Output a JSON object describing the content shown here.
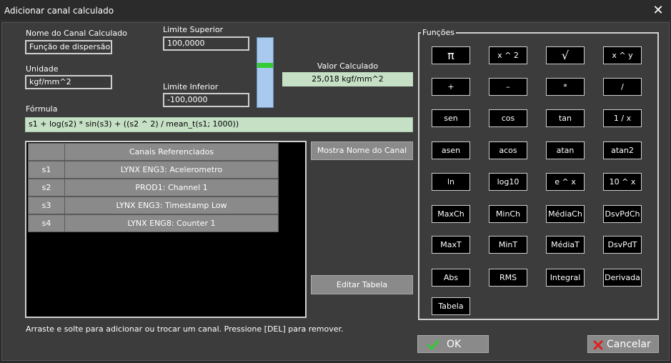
{
  "window": {
    "title": "Adicionar canal calculado",
    "close_glyph": "✕"
  },
  "form": {
    "channel_name_label": "Nome do Canal Calculado",
    "channel_name_value": "Função de dispersão",
    "unit_label": "Unidade",
    "unit_value": "kgf/mm^2",
    "upper_limit_label": "Limite Superior",
    "upper_limit_value": "100,0000",
    "lower_limit_label": "Limite Inferior",
    "lower_limit_value": "-100,0000",
    "calc_value_label": "Valor Calculado",
    "calc_value": "25,018 kgf/mm^2",
    "formula_label": "Fórmula",
    "formula_value": "s1 + log(s2) * sin(s3) + ((s2 ^ 2) / mean_t(s1; 1000))"
  },
  "table": {
    "header": "Canais Referenciados",
    "rows": [
      {
        "id": "s1",
        "channel": "LYNX ENG3: Acelerometro"
      },
      {
        "id": "s2",
        "channel": "PROD1: Channel 1"
      },
      {
        "id": "s3",
        "channel": "LYNX ENG3: Timestamp Low"
      },
      {
        "id": "s4",
        "channel": "LYNX ENG8: Counter 1"
      }
    ]
  },
  "buttons": {
    "show_name": "Mostra Nome do Canal",
    "edit_table": "Editar Tabela",
    "ok": "OK",
    "cancel": "Cancelar"
  },
  "hint": "Arraste e solte para adicionar ou trocar um canal. Pressione [DEL] para remover.",
  "functions": {
    "legend": "Funções",
    "items": [
      {
        "label": "π",
        "name": "pi"
      },
      {
        "label": "x ^ 2",
        "name": "square"
      },
      {
        "label": "√",
        "name": "sqrt"
      },
      {
        "label": "x ^ y",
        "name": "power"
      },
      {
        "label": "+",
        "name": "plus"
      },
      {
        "label": "–",
        "name": "minus"
      },
      {
        "label": "*",
        "name": "multiply"
      },
      {
        "label": "/",
        "name": "divide"
      },
      {
        "label": "sen",
        "name": "sen"
      },
      {
        "label": "cos",
        "name": "cos"
      },
      {
        "label": "tan",
        "name": "tan"
      },
      {
        "label": "1 / x",
        "name": "reciprocal"
      },
      {
        "label": "asen",
        "name": "asen"
      },
      {
        "label": "acos",
        "name": "acos"
      },
      {
        "label": "atan",
        "name": "atan"
      },
      {
        "label": "atan2",
        "name": "atan2"
      },
      {
        "label": "ln",
        "name": "ln"
      },
      {
        "label": "log10",
        "name": "log10"
      },
      {
        "label": "e ^ x",
        "name": "exp"
      },
      {
        "label": "10 ^ x",
        "name": "pow10"
      },
      {
        "label": "MaxCh",
        "name": "maxch"
      },
      {
        "label": "MinCh",
        "name": "minch"
      },
      {
        "label": "MédiaCh",
        "name": "mediach"
      },
      {
        "label": "DsvPdCh",
        "name": "dsvpdch"
      },
      {
        "label": "MaxT",
        "name": "maxt"
      },
      {
        "label": "MinT",
        "name": "mint"
      },
      {
        "label": "MédiaT",
        "name": "mediat"
      },
      {
        "label": "DsvPdT",
        "name": "dsvpdt"
      },
      {
        "label": "Abs",
        "name": "abs"
      },
      {
        "label": "RMS",
        "name": "rms"
      },
      {
        "label": "Integral",
        "name": "integral"
      },
      {
        "label": "Derivada",
        "name": "derivada"
      },
      {
        "label": "Tabela",
        "name": "tabela"
      }
    ]
  },
  "colors": {
    "value_bg": "#c6e0c6",
    "slider_track": "#a9c9ee",
    "slider_thumb": "#33cc33",
    "ok_icon": "#33cc33",
    "cancel_icon": "#e02020"
  },
  "icons": {
    "ok": "check-icon",
    "cancel": "x-icon"
  }
}
